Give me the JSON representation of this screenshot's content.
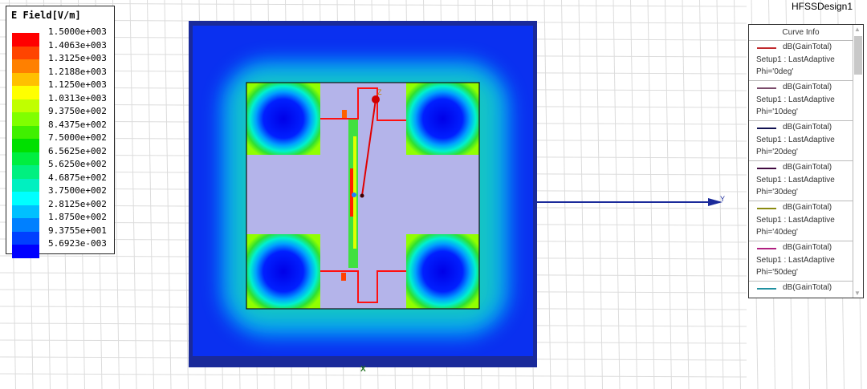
{
  "legend": {
    "title": "E Field[V/m]",
    "levels": [
      {
        "value": "1.5000e+003",
        "color": "#ff0000"
      },
      {
        "value": "1.4063e+003",
        "color": "#ff4400"
      },
      {
        "value": "1.3125e+003",
        "color": "#ff8000"
      },
      {
        "value": "1.2188e+003",
        "color": "#ffc000"
      },
      {
        "value": "1.1250e+003",
        "color": "#ffff00"
      },
      {
        "value": "1.0313e+003",
        "color": "#c0ff00"
      },
      {
        "value": "9.3750e+002",
        "color": "#80ff00"
      },
      {
        "value": "8.4375e+002",
        "color": "#40f000"
      },
      {
        "value": "7.5000e+002",
        "color": "#00e000"
      },
      {
        "value": "6.5625e+002",
        "color": "#00ee40"
      },
      {
        "value": "5.6250e+002",
        "color": "#00f080"
      },
      {
        "value": "4.6875e+002",
        "color": "#00f0c0"
      },
      {
        "value": "3.7500e+002",
        "color": "#00ffff"
      },
      {
        "value": "2.8125e+002",
        "color": "#00c0ff"
      },
      {
        "value": "1.8750e+002",
        "color": "#0080ff"
      },
      {
        "value": "9.3755e+001",
        "color": "#0040ff"
      },
      {
        "value": "5.6923e-003",
        "color": "#0000ff"
      }
    ]
  },
  "design_name": "HFSSDesign1",
  "curve_info": {
    "title": "Curve Info",
    "entries": [
      {
        "expr": "dB(GainTotal)",
        "setup": "Setup1 : LastAdaptive",
        "param": "Phi='0deg'",
        "color": "#c0282c"
      },
      {
        "expr": "dB(GainTotal)",
        "setup": "Setup1 : LastAdaptive",
        "param": "Phi='10deg'",
        "color": "#7a4a6a"
      },
      {
        "expr": "dB(GainTotal)",
        "setup": "Setup1 : LastAdaptive",
        "param": "Phi='20deg'",
        "color": "#101050"
      },
      {
        "expr": "dB(GainTotal)",
        "setup": "Setup1 : LastAdaptive",
        "param": "Phi='30deg'",
        "color": "#400a40"
      },
      {
        "expr": "dB(GainTotal)",
        "setup": "Setup1 : LastAdaptive",
        "param": "Phi='40deg'",
        "color": "#8a8a10"
      },
      {
        "expr": "dB(GainTotal)",
        "setup": "Setup1 : LastAdaptive",
        "param": "Phi='50deg'",
        "color": "#b02080"
      },
      {
        "expr": "dB(GainTotal)",
        "setup": "",
        "param": "",
        "color": "#2090a0"
      }
    ]
  },
  "axes": {
    "x": "X",
    "y": "Y",
    "z": "Z"
  }
}
